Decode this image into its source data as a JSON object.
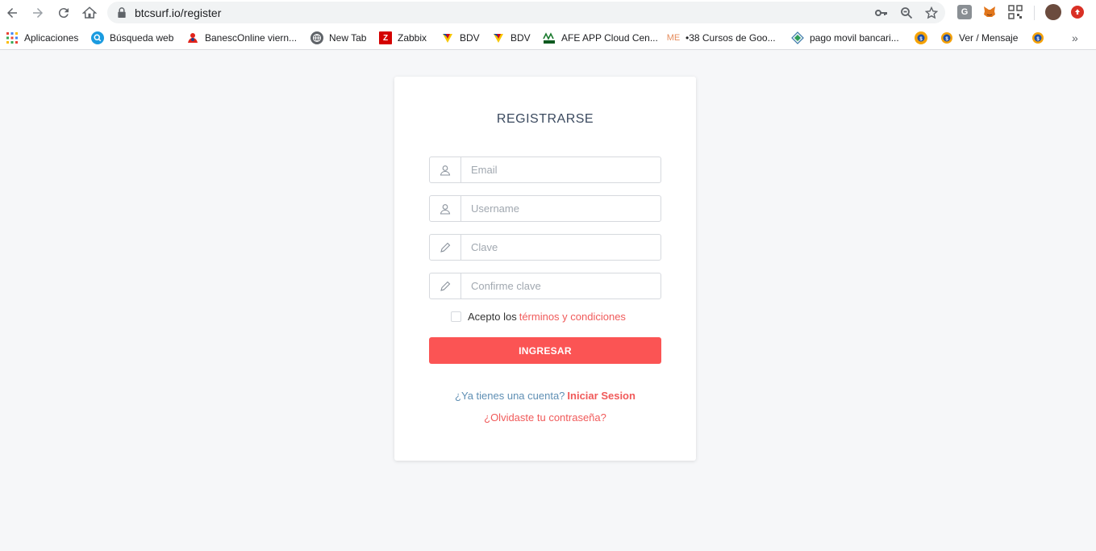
{
  "browser": {
    "url": "btcsurf.io/register",
    "bookmarks": [
      {
        "label": "Aplicaciones",
        "icon": "apps-grid-icon"
      },
      {
        "label": "Búsqueda web",
        "icon": "search-web-icon"
      },
      {
        "label": "BanescOnline viern...",
        "icon": "banesco-icon"
      },
      {
        "label": "New Tab",
        "icon": "globe-icon"
      },
      {
        "label": "Zabbix",
        "icon": "zabbix-icon"
      },
      {
        "label": "BDV",
        "icon": "bdv-icon"
      },
      {
        "label": "BDV",
        "icon": "bdv-icon"
      },
      {
        "label": "AFE APP Cloud Cen...",
        "icon": "afe-icon"
      },
      {
        "label": "•38 Cursos de Goo...",
        "icon": "me-icon"
      },
      {
        "label": "pago movil bancari...",
        "icon": "diamond-icon"
      },
      {
        "label": "",
        "icon": "coin-icon"
      },
      {
        "label": "Ver / Mensaje",
        "icon": "coin-icon"
      },
      {
        "label": "",
        "icon": "coin-icon"
      }
    ]
  },
  "form": {
    "title": "REGISTRARSE",
    "email_placeholder": "Email",
    "username_placeholder": "Username",
    "password_placeholder": "Clave",
    "confirm_placeholder": "Confirme clave",
    "terms_prefix": "Acepto los",
    "terms_link": "términos y condiciones",
    "submit_label": "INGRESAR",
    "have_account": "¿Ya tienes una cuenta?",
    "login_link": "Iniciar Sesion",
    "forgot_link": "¿Olvidaste tu contraseña?"
  },
  "colors": {
    "accent": "#fb5454",
    "link": "#f05a5a",
    "page_bg": "#f6f7f9"
  }
}
